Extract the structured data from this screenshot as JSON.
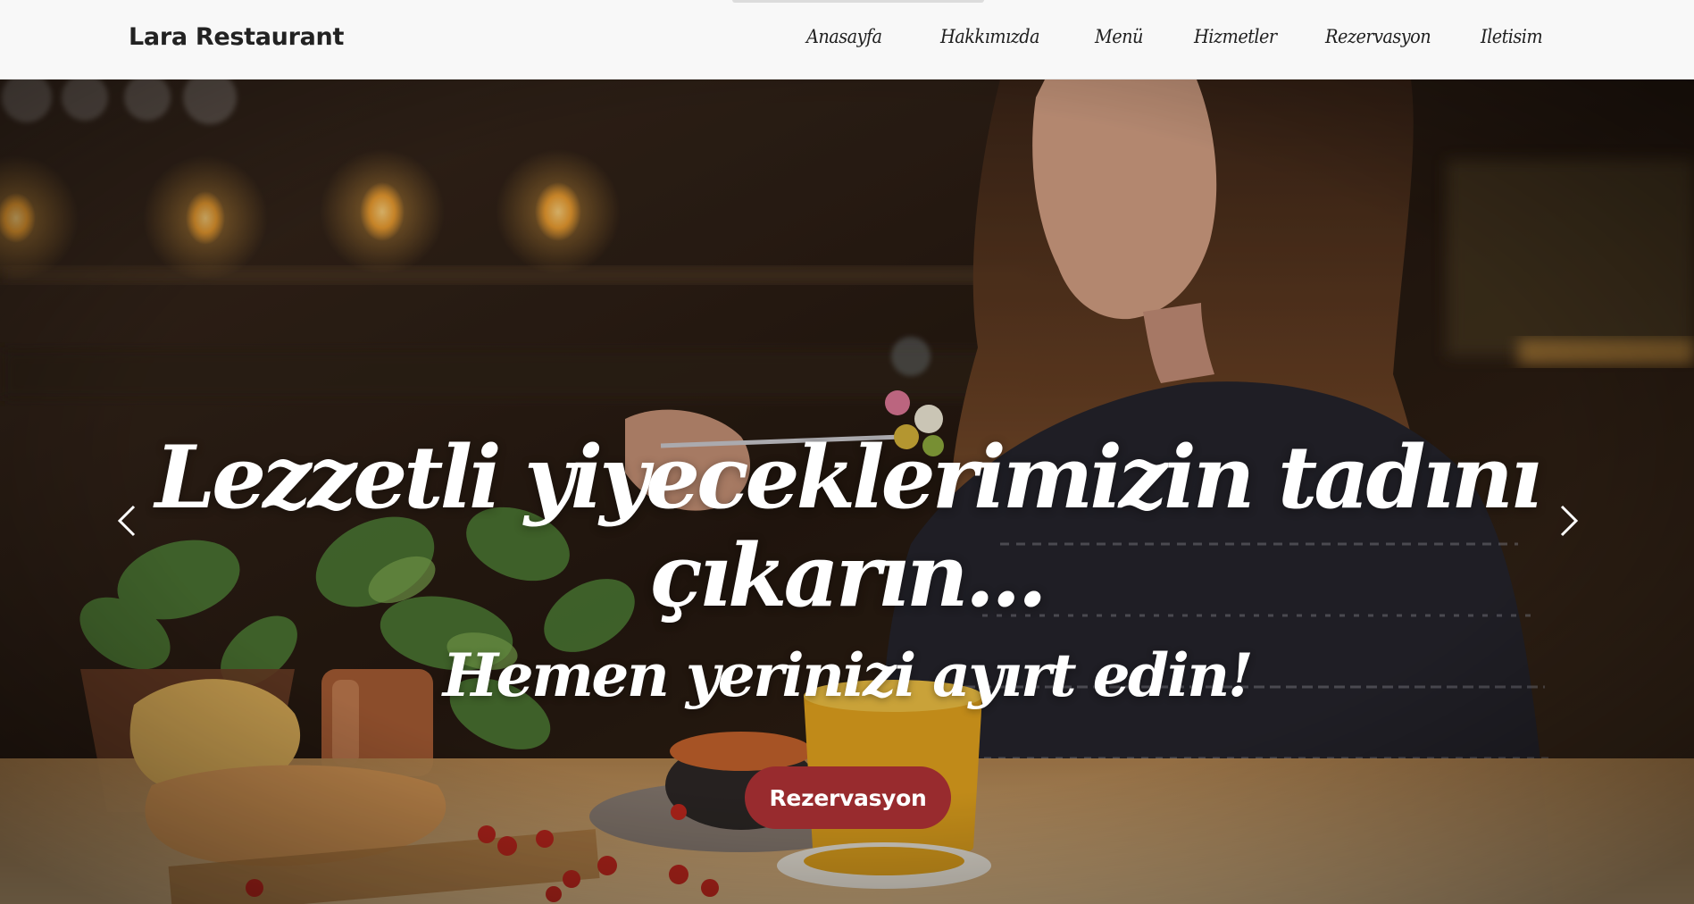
{
  "navbar": {
    "brand": "Lara Restaurant",
    "links": [
      "Anasayfa",
      "Hakkımızda",
      "Menü",
      "Hizmetler",
      "Rezervasyon",
      "Iletisim"
    ]
  },
  "hero": {
    "title_line1": "Lezzetli yiyeceklerimizin tadını",
    "title_line2": "çıkarın...",
    "subtitle": "Hemen yerinizi ayırt edin!",
    "cta_label": "Rezervasyon",
    "prev_icon": "chevron-left-icon",
    "next_icon": "chevron-right-icon"
  },
  "colors": {
    "navbar_bg": "#f8f8f8",
    "cta_bg": "#982b2e",
    "hero_text": "#ffffff"
  }
}
